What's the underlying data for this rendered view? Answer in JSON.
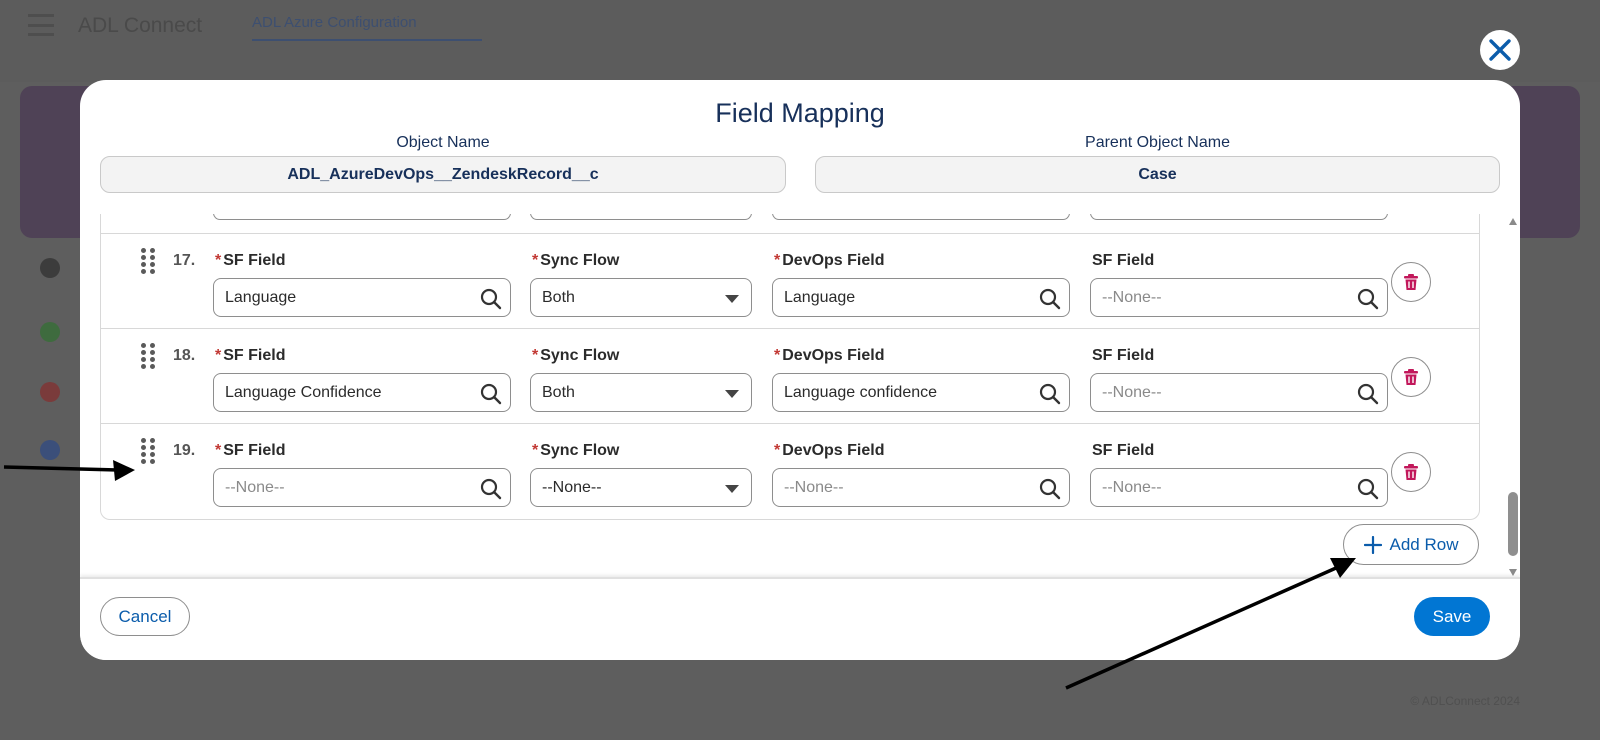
{
  "background": {
    "app_title": "ADL Connect",
    "tab_label": "ADL Azure Configuration",
    "footer_text": "© ADLConnect 2024"
  },
  "modal": {
    "title": "Field Mapping",
    "object_name_label": "Object Name",
    "object_name_value": "ADL_AzureDevOps__ZendeskRecord__c",
    "parent_object_label": "Parent Object Name",
    "parent_object_value": "Case"
  },
  "rows": [
    {
      "number": "17.",
      "sf_field_label": "SF Field",
      "sf_field_value": "Language",
      "sync_flow_label": "Sync Flow",
      "sync_flow_value": "Both",
      "devops_field_label": "DevOps Field",
      "devops_field_value": "Language",
      "sf_field2_label": "SF Field",
      "sf_field2_placeholder": "--None--"
    },
    {
      "number": "18.",
      "sf_field_label": "SF Field",
      "sf_field_value": "Language Confidence",
      "sync_flow_label": "Sync Flow",
      "sync_flow_value": "Both",
      "devops_field_label": "DevOps Field",
      "devops_field_value": "Language confidence",
      "sf_field2_label": "SF Field",
      "sf_field2_placeholder": "--None--"
    },
    {
      "number": "19.",
      "sf_field_label": "SF Field",
      "sf_field_placeholder": "--None--",
      "sync_flow_label": "Sync Flow",
      "sync_flow_value": "--None--",
      "devops_field_label": "DevOps Field",
      "devops_field_placeholder": "--None--",
      "sf_field2_label": "SF Field",
      "sf_field2_placeholder": "--None--"
    }
  ],
  "buttons": {
    "add_row": "Add Row",
    "cancel": "Cancel",
    "save": "Save"
  },
  "colors": {
    "brand_blue": "#0176d3",
    "link_blue": "#0b5cab",
    "required_red": "#c23934",
    "delete_pink": "#c2185b",
    "title_navy": "#17305a"
  },
  "icons": {
    "close": "close-icon",
    "search": "search-icon",
    "delete": "trash-icon",
    "drag": "drag-handle-icon",
    "add": "plus-icon"
  }
}
